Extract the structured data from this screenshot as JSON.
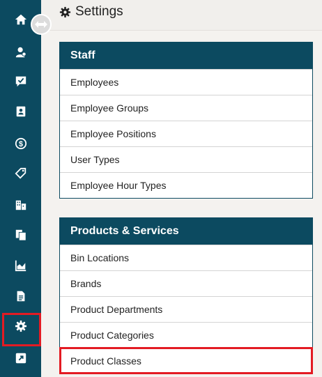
{
  "sidebar": {
    "items": [
      {
        "icon": "home-icon"
      },
      {
        "icon": "customer-icon"
      },
      {
        "icon": "checklist-icon"
      },
      {
        "icon": "contact-card-icon"
      },
      {
        "icon": "dollar-icon"
      },
      {
        "icon": "tags-icon"
      },
      {
        "icon": "buildings-icon"
      },
      {
        "icon": "documents-icon"
      },
      {
        "icon": "area-chart-icon"
      },
      {
        "icon": "file-text-icon"
      },
      {
        "icon": "gear-icon",
        "highlighted": true
      },
      {
        "icon": "external-link-icon"
      }
    ]
  },
  "header": {
    "title": "Settings"
  },
  "sections": [
    {
      "title": "Staff",
      "items": [
        "Employees",
        "Employee Groups",
        "Employee Positions",
        "User Types",
        "Employee Hour Types"
      ]
    },
    {
      "title": "Products & Services",
      "items": [
        "Bin Locations",
        "Brands",
        "Product Departments",
        "Product Categories",
        "Product Classes"
      ]
    }
  ],
  "colors": {
    "sidebar": "#0c4a60",
    "highlight": "#e31b23",
    "background": "#f4f2ef"
  }
}
